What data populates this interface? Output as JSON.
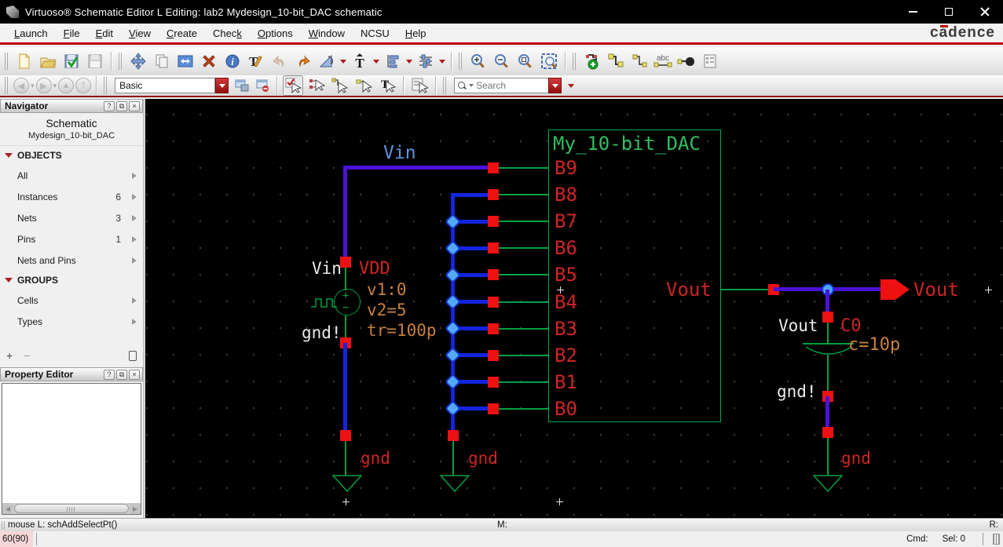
{
  "window": {
    "title": "Virtuoso® Schematic Editor L Editing: lab2 Mydesign_10-bit_DAC schematic"
  },
  "menu": {
    "items": [
      {
        "label": "Launch",
        "accel": 0
      },
      {
        "label": "File",
        "accel": 0
      },
      {
        "label": "Edit",
        "accel": 0
      },
      {
        "label": "View",
        "accel": 0
      },
      {
        "label": "Create",
        "accel": 0
      },
      {
        "label": "Check",
        "accel": 4
      },
      {
        "label": "Options",
        "accel": 0
      },
      {
        "label": "Window",
        "accel": 0
      },
      {
        "label": "NCSU",
        "accel": -1
      },
      {
        "label": "Help",
        "accel": 0
      }
    ],
    "logo": "cadence"
  },
  "toolbar_main_icons": [
    "new-file-icon",
    "open-icon",
    "check-and-save-icon",
    "save-icon",
    "move-icon",
    "copy-icon",
    "stretch-icon",
    "delete-icon",
    "properties-icon",
    "edit-label-icon",
    "undo-icon",
    "redo-icon",
    "rotate-icon",
    "create-text-icon",
    "align-icon",
    "distribute-icon",
    "zoom-in-icon",
    "zoom-out-icon",
    "zoom-selected-icon",
    "fit-to-screen-icon",
    "create-instance-icon",
    "create-wire-icon",
    "create-narrow-wire-icon",
    "create-wire-name-icon",
    "create-pin-icon",
    "create-note-icon"
  ],
  "toolbar_secondary": {
    "workspace_value": "Basic",
    "search_placeholder": "Search",
    "icons": [
      "nav-back-icon",
      "nav-forward-icon",
      "nav-up-icon",
      "nav-top-icon",
      "save-workspace-icon",
      "delete-workspace-icon",
      "full-select-icon",
      "partial-select-icon",
      "wire-select-icon",
      "instance-select-icon",
      "text-select-icon",
      "selection-filter-icon",
      "search-icon"
    ]
  },
  "navigator": {
    "title": "Navigator",
    "help_btn": "?",
    "float_btn": "⧉",
    "close_btn": "×",
    "view_type": "Schematic",
    "cell_name": "Mydesign_10-bit_DAC",
    "sections": [
      {
        "label": "OBJECTS",
        "items": [
          {
            "label": "All",
            "count": ""
          },
          {
            "label": "Instances",
            "count": "6"
          },
          {
            "label": "Nets",
            "count": "3"
          },
          {
            "label": "Pins",
            "count": "1"
          },
          {
            "label": "Nets and Pins",
            "count": ""
          }
        ]
      },
      {
        "label": "GROUPS",
        "items": [
          {
            "label": "Cells",
            "count": ""
          },
          {
            "label": "Types",
            "count": ""
          }
        ]
      }
    ],
    "add_label": "+",
    "remove_label": "−"
  },
  "property_editor": {
    "title": "Property Editor",
    "help_btn": "?",
    "float_btn": "⧉",
    "close_btn": "×"
  },
  "schematic": {
    "vin_net_label": "Vin",
    "source": {
      "pin_label": "Vin",
      "net_label": "VDD",
      "param1": "v1:0",
      "param2": "v2=5",
      "param3": "tr=100p",
      "ground_net": "gnd!"
    },
    "dac": {
      "title": "My_10-bit_DAC",
      "pins": [
        "B9",
        "B8",
        "B7",
        "B6",
        "B5",
        "B4",
        "B3",
        "B2",
        "B1",
        "B0"
      ],
      "output_label": "Vout"
    },
    "output": {
      "pin_label": "Vout",
      "node_label": "Vout",
      "cap_name": "C0",
      "cap_value": "c=10p",
      "ground_net": "gnd!"
    },
    "ground_labels": [
      "gnd",
      "gnd",
      "gnd"
    ]
  },
  "status": {
    "mouse": "mouse L: schAddSelectPt()",
    "m_label": "M:",
    "r_label": "R:",
    "coords": "60(90)",
    "cmd_label": "Cmd:",
    "sel_label": "Sel: 0"
  }
}
